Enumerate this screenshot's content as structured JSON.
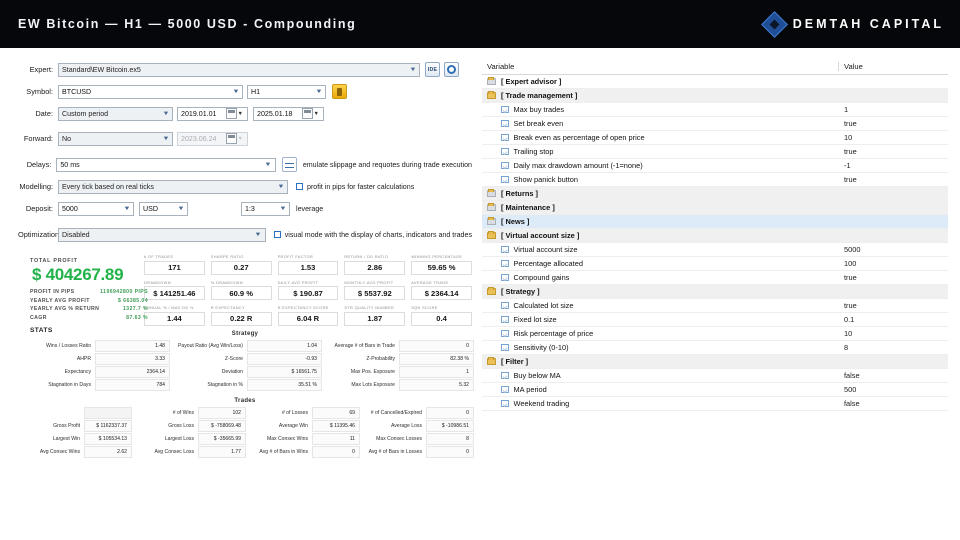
{
  "header": {
    "title": "EW Bitcoin — H1 — 5000 USD - Compounding",
    "brand": "DEMTAH CAPITAL",
    "brand_icon": "diamond-logo-icon"
  },
  "settings": {
    "expert_label": "Expert:",
    "expert_value": "Standard\\EW Bitcoin.ex5",
    "ide_button": "IDE",
    "gear_button_icon": "gear-icon",
    "symbol_label": "Symbol:",
    "symbol_value": "BTCUSD",
    "timeframe_value": "H1",
    "symbol_extra_icon": "yellow-bar-icon",
    "date_label": "Date:",
    "date_mode": "Custom period",
    "date_from": "2019.01.01",
    "date_to": "2025.01.18",
    "forward_label": "Forward:",
    "forward_value": "No",
    "forward_date": "2023.06.24",
    "delays_label": "Delays:",
    "delays_value": "50 ms",
    "delays_icon": "slider-settings-icon",
    "delays_note": "emulate slippage and requotes during trade execution",
    "modelling_label": "Modelling:",
    "modelling_value": "Every tick based on real ticks",
    "modelling_note": "profit in pips for faster calculations",
    "deposit_label": "Deposit:",
    "deposit_value": "5000",
    "currency_value": "USD",
    "leverage_value": "1:3",
    "leverage_note": "leverage",
    "optimization_label": "Optimization:",
    "optimization_value": "Disabled",
    "optimization_note": "visual mode with the display of charts, indicators and trades"
  },
  "summary": {
    "total_profit_caption": "TOTAL PROFIT",
    "total_profit_value": "$ 404267.89",
    "rows": [
      {
        "key": "PROFIT IN PIPS",
        "value": "1196942800 PIPS"
      },
      {
        "key": "YEARLY AVG PROFIT",
        "value": "$ 66385.04"
      },
      {
        "key": "YEARLY AVG % RETURN",
        "value": "1327.7 %"
      },
      {
        "key": "CAGR",
        "value": "87.63 %"
      }
    ],
    "stats_label": "STATS"
  },
  "metric_cards": [
    [
      {
        "caption": "# OF TRADES",
        "value": "171"
      },
      {
        "caption": "SHARPE RATIO",
        "value": "0.27"
      },
      {
        "caption": "PROFIT FACTOR",
        "value": "1.53"
      },
      {
        "caption": "RETURN / DD RATIO",
        "value": "2.86"
      },
      {
        "caption": "WINNING PERCENTAGE",
        "value": "59.65 %"
      }
    ],
    [
      {
        "caption": "DRAWDOWN",
        "value": "$ 141251.46"
      },
      {
        "caption": "% DRAWDOWN",
        "value": "60.9 %"
      },
      {
        "caption": "DAILY AVG PROFIT",
        "value": "$ 190.87"
      },
      {
        "caption": "MONTHLY AVG PROFIT",
        "value": "$ 5537.92"
      },
      {
        "caption": "AVERAGE TRADE",
        "value": "$ 2364.14"
      }
    ],
    [
      {
        "caption": "ANNUAL % / MAX DD %",
        "value": "1.44"
      },
      {
        "caption": "R EXPECTANCY",
        "value": "0.22 R"
      },
      {
        "caption": "R EXPECTANCY SCORE",
        "value": "6.04 R"
      },
      {
        "caption": "STR QUALITY NUMBER",
        "value": "1.87"
      },
      {
        "caption": "SQN SCORE",
        "value": "0.4"
      }
    ]
  ],
  "strategy_table": {
    "title": "Strategy",
    "rows": [
      [
        {
          "label": "Wins / Losses Ratio",
          "value": "1.48"
        },
        {
          "label": "Payout Ratio (Avg Win/Loss)",
          "value": "1.04"
        },
        {
          "label": "Average # of Bars in Trade",
          "value": "0"
        }
      ],
      [
        {
          "label": "AHPR",
          "value": "3.33"
        },
        {
          "label": "Z-Score",
          "value": "-0.93"
        },
        {
          "label": "Z-Probability",
          "value": "82.38 %"
        }
      ],
      [
        {
          "label": "Expectancy",
          "value": "2364.14"
        },
        {
          "label": "Deviation",
          "value": "$ 16561.75"
        },
        {
          "label": "Max Pos. Exposure",
          "value": "1"
        }
      ],
      [
        {
          "label": "Stagnation in Days",
          "value": "784"
        },
        {
          "label": "Stagnation in %",
          "value": "35.51 %"
        },
        {
          "label": "Max Lots Exposure",
          "value": "5.32"
        }
      ]
    ]
  },
  "trades_table": {
    "title": "Trades",
    "rows": [
      [
        {
          "label": "",
          "value": ""
        },
        {
          "label": "# of Wins",
          "value": "102"
        },
        {
          "label": "# of Losses",
          "value": "69"
        },
        {
          "label": "# of Cancelled/Expired",
          "value": "0"
        }
      ],
      [
        {
          "label": "Gross Profit",
          "value": "$ 1162337.37"
        },
        {
          "label": "Gross Loss",
          "value": "$ -758069.48"
        },
        {
          "label": "Average Win",
          "value": "$ 11395.46"
        },
        {
          "label": "Average Loss",
          "value": "$ -10986.51"
        }
      ],
      [
        {
          "label": "Largest Win",
          "value": "$ 105534.13"
        },
        {
          "label": "Largest Loss",
          "value": "$ -35665.99"
        },
        {
          "label": "Max Consec Wins",
          "value": "11"
        },
        {
          "label": "Max Consec Losses",
          "value": "8"
        }
      ],
      [
        {
          "label": "Avg Consec Wins",
          "value": "2.62"
        },
        {
          "label": "Avg Consec Loss",
          "value": "1.77"
        },
        {
          "label": "Avg # of Bars in Wins",
          "value": "0"
        },
        {
          "label": "Avg # of Bars in Losses",
          "value": "0"
        }
      ]
    ]
  },
  "variables": {
    "col_variable": "Variable",
    "col_value": "Value",
    "rows": [
      {
        "type": "group",
        "icon": "folder-closed-icon",
        "name": "[ Expert advisor ]",
        "value": "",
        "shade": "alt"
      },
      {
        "type": "group",
        "icon": "folder-open-icon",
        "name": "[ Trade management ]",
        "value": "",
        "shade": "grey"
      },
      {
        "type": "item",
        "name": "Max buy trades",
        "value": "1"
      },
      {
        "type": "item",
        "name": "Set break even",
        "value": "true"
      },
      {
        "type": "item",
        "name": "Break even as percentage of open price",
        "value": "10"
      },
      {
        "type": "item",
        "name": "Trailing stop",
        "value": "true"
      },
      {
        "type": "item",
        "name": "Daily max drawdown amount (-1=none)",
        "value": "-1"
      },
      {
        "type": "item",
        "name": "Show panick button",
        "value": "true"
      },
      {
        "type": "group",
        "icon": "folder-closed-icon",
        "name": "[ Returns ]",
        "value": "",
        "shade": "grey"
      },
      {
        "type": "group",
        "icon": "folder-closed-icon",
        "name": "[ Maintenance ]",
        "value": "",
        "shade": "grey"
      },
      {
        "type": "group",
        "icon": "folder-closed-icon",
        "name": "[ News ]",
        "value": "",
        "shade": "selected"
      },
      {
        "type": "group",
        "icon": "folder-open-icon",
        "name": "[ Virtual account size ]",
        "value": "",
        "shade": "grey"
      },
      {
        "type": "item",
        "name": "Virtual account size",
        "value": "5000"
      },
      {
        "type": "item",
        "name": "Percentage allocated",
        "value": "100"
      },
      {
        "type": "item",
        "name": "Compound gains",
        "value": "true"
      },
      {
        "type": "group",
        "icon": "folder-open-icon",
        "name": "[ Strategy ]",
        "value": "",
        "shade": "grey"
      },
      {
        "type": "item",
        "name": "Calculated lot size",
        "value": "true"
      },
      {
        "type": "item",
        "name": "Fixed lot size",
        "value": "0.1"
      },
      {
        "type": "item",
        "name": "Risk percentage of price",
        "value": "10"
      },
      {
        "type": "item",
        "name": "Sensitivity (0-10)",
        "value": "8"
      },
      {
        "type": "group",
        "icon": "folder-open-icon",
        "name": "[ Filter ]",
        "value": "",
        "shade": "grey"
      },
      {
        "type": "item",
        "name": "Buy below MA",
        "value": "false"
      },
      {
        "type": "item",
        "name": "MA period",
        "value": "500"
      },
      {
        "type": "item",
        "name": "Weekend trading",
        "value": "false"
      }
    ]
  },
  "colors": {
    "header_bg": "#05070b",
    "profit_green": "#21b34a",
    "stat_green": "#3f9d57",
    "group_row_bg": "#f0f0f0",
    "selected_row_bg": "#ddeaf7",
    "accent_blue": "#2f6fb4"
  }
}
